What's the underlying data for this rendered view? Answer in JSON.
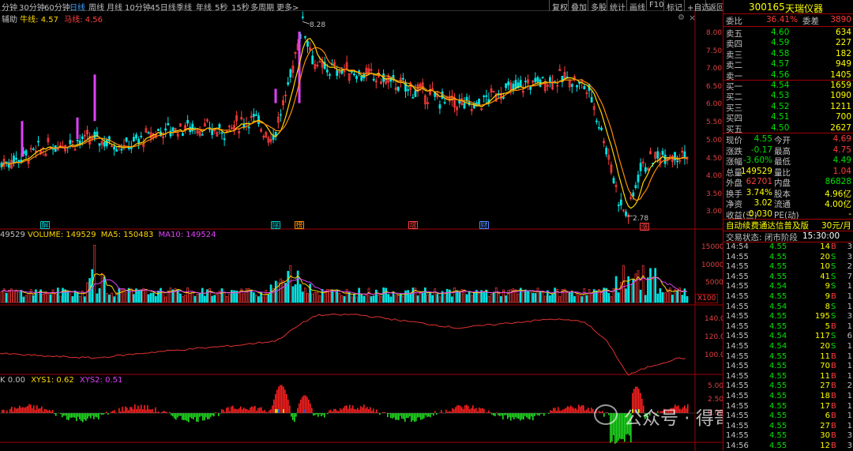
{
  "toolbar": {
    "periods": [
      "分钟",
      "30分钟",
      "60分钟",
      "日线",
      "周线",
      "月线",
      "10分钟",
      "45日线",
      "季线",
      "年线",
      "5秒",
      "15秒",
      "多周期",
      "更多>"
    ],
    "active_period": "日线",
    "buttons": [
      "复权",
      "叠加",
      "多股",
      "统计",
      "画线",
      "F10",
      "标记",
      "+自选",
      "返回"
    ]
  },
  "main_chart": {
    "legend_prefix": "辅助",
    "legend_a_name": "牛线:",
    "legend_a_value": "4.57",
    "legend_b_name": "马线:",
    "legend_b_value": "4.56",
    "high_label": "8.28",
    "low_label": "2.78",
    "y_axis": [
      "8.00",
      "7.50",
      "7.00",
      "6.50",
      "6.00",
      "5.50",
      "5.00",
      "4.50",
      "4.00",
      "3.50",
      "3.00"
    ],
    "event_markers": [
      {
        "text": "解",
        "color": "#00c8c8"
      },
      {
        "text": "除",
        "color": "#00c8c8"
      },
      {
        "text": "榜",
        "color": "#ff8c00"
      },
      {
        "text": "增",
        "color": "#ff4040"
      },
      {
        "text": "财",
        "color": "#4a90ff"
      },
      {
        "text": "涨",
        "color": "#ff4040"
      }
    ]
  },
  "volume_panel": {
    "cut_value": "49529",
    "vol_label": "VOLUME: 149529",
    "ma5_label": "MA5: 150483",
    "ma10_label": "MA10: 149524",
    "y_axis": [
      "15000",
      "10000",
      "5000"
    ],
    "unit": "X100"
  },
  "ind_panel": {
    "y_axis": [
      "140.0",
      "120.0",
      "100.0"
    ]
  },
  "xys_panel": {
    "k_label": "K 0.00",
    "xys1_label": "XYS1: 0.62",
    "xys2_label": "XYS2: 0.51",
    "y_axis": [
      "5.00",
      "2.50",
      "0.00"
    ]
  },
  "quote": {
    "code": "300165",
    "name": "天瑞仪器",
    "wei_bi_label": "委比",
    "wei_bi": "36.41%",
    "wei_cha_label": "委差",
    "wei_cha": "3890",
    "asks": [
      {
        "label": "卖五",
        "price": "4.60",
        "vol": "634"
      },
      {
        "label": "卖四",
        "price": "4.59",
        "vol": "227"
      },
      {
        "label": "卖三",
        "price": "4.58",
        "vol": "182"
      },
      {
        "label": "卖二",
        "price": "4.57",
        "vol": "949"
      },
      {
        "label": "卖一",
        "price": "4.56",
        "vol": "1405"
      }
    ],
    "bids": [
      {
        "label": "买一",
        "price": "4.54",
        "vol": "1659"
      },
      {
        "label": "买二",
        "price": "4.53",
        "vol": "1090"
      },
      {
        "label": "买三",
        "price": "4.52",
        "vol": "1211"
      },
      {
        "label": "买四",
        "price": "4.51",
        "vol": "700"
      },
      {
        "label": "买五",
        "price": "4.50",
        "vol": "2627"
      }
    ],
    "stats": [
      {
        "l1": "现价",
        "v1": "4.55",
        "l2": "今开",
        "v2": "4.69"
      },
      {
        "l1": "涨跌",
        "v1": "-0.17",
        "l2": "最高",
        "v2": "4.75"
      },
      {
        "l1": "涨幅",
        "v1": "-3.60%",
        "l2": "最低",
        "v2": "4.49"
      },
      {
        "l1": "总量",
        "v1": "149529",
        "l2": "量比",
        "v2": "1.04"
      },
      {
        "l1": "外盘",
        "v1": "62701",
        "l2": "内盘",
        "v2": "86828"
      },
      {
        "l1": "换手",
        "v1": "3.74%",
        "l2": "股本",
        "v2": "4.96亿"
      },
      {
        "l1": "净资",
        "v1": "3.02",
        "l2": "流通",
        "v2": "4.00亿"
      },
      {
        "l1": "收益(三)",
        "v1": "-0.030",
        "l2": "PE(动)",
        "v2": "-"
      }
    ],
    "ad_text": "自动续费通达信普及版",
    "ad_price": "30元/月",
    "trade_state": "交易状态: 闭市阶段",
    "trade_time": "15:30:00"
  },
  "ticks": [
    {
      "t": "14:54",
      "p": "4.55",
      "v": "14",
      "d": "B",
      "n": "3"
    },
    {
      "t": "14:55",
      "p": "4.55",
      "v": "20",
      "d": "S",
      "n": "3"
    },
    {
      "t": "14:55",
      "p": "4.55",
      "v": "10",
      "d": "S",
      "n": "2"
    },
    {
      "t": "14:55",
      "p": "4.55",
      "v": "41",
      "d": "S",
      "n": "7"
    },
    {
      "t": "14:55",
      "p": "4.54",
      "v": "9",
      "d": "S",
      "n": "1"
    },
    {
      "t": "14:55",
      "p": "4.55",
      "v": "9",
      "d": "B",
      "n": "1"
    },
    {
      "t": "14:55",
      "p": "4.54",
      "v": "8",
      "d": "S",
      "n": "1"
    },
    {
      "t": "14:55",
      "p": "4.55",
      "v": "195",
      "d": "S",
      "n": "3"
    },
    {
      "t": "14:55",
      "p": "4.55",
      "v": "5",
      "d": "B",
      "n": "1"
    },
    {
      "t": "14:55",
      "p": "4.54",
      "v": "117",
      "d": "S",
      "n": "6"
    },
    {
      "t": "14:55",
      "p": "4.54",
      "v": "20",
      "d": "S",
      "n": "1"
    },
    {
      "t": "14:55",
      "p": "4.55",
      "v": "11",
      "d": "B",
      "n": "1"
    },
    {
      "t": "14:55",
      "p": "4.55",
      "v": "70",
      "d": "B",
      "n": "1"
    },
    {
      "t": "14:55",
      "p": "4.55",
      "v": "11",
      "d": "B",
      "n": "1"
    },
    {
      "t": "14:55",
      "p": "4.55",
      "v": "27",
      "d": "B",
      "n": "2"
    },
    {
      "t": "14:55",
      "p": "4.55",
      "v": "18",
      "d": "B",
      "n": "1"
    },
    {
      "t": "14:55",
      "p": "4.55",
      "v": "17",
      "d": "B",
      "n": "1"
    },
    {
      "t": "14:55",
      "p": "4.55",
      "v": "6",
      "d": "B",
      "n": "1"
    },
    {
      "t": "14:55",
      "p": "4.55",
      "v": "27",
      "d": "B",
      "n": "1"
    },
    {
      "t": "14:55",
      "p": "4.55",
      "v": "30",
      "d": "B",
      "n": "3"
    },
    {
      "t": "14:56",
      "p": "4.55",
      "v": "12",
      "d": "B",
      "n": "3"
    }
  ],
  "watermark": "公众号 · 得哥抓板",
  "colors": {
    "up": "#ff3b3b",
    "down": "#00e3e3",
    "ma_yellow": "#ffd700",
    "ma_orange": "#ff8c00",
    "ma_purple": "#e040fb",
    "grid_red": "#a00000",
    "green": "#00ff00",
    "yellow": "#ffff00"
  }
}
